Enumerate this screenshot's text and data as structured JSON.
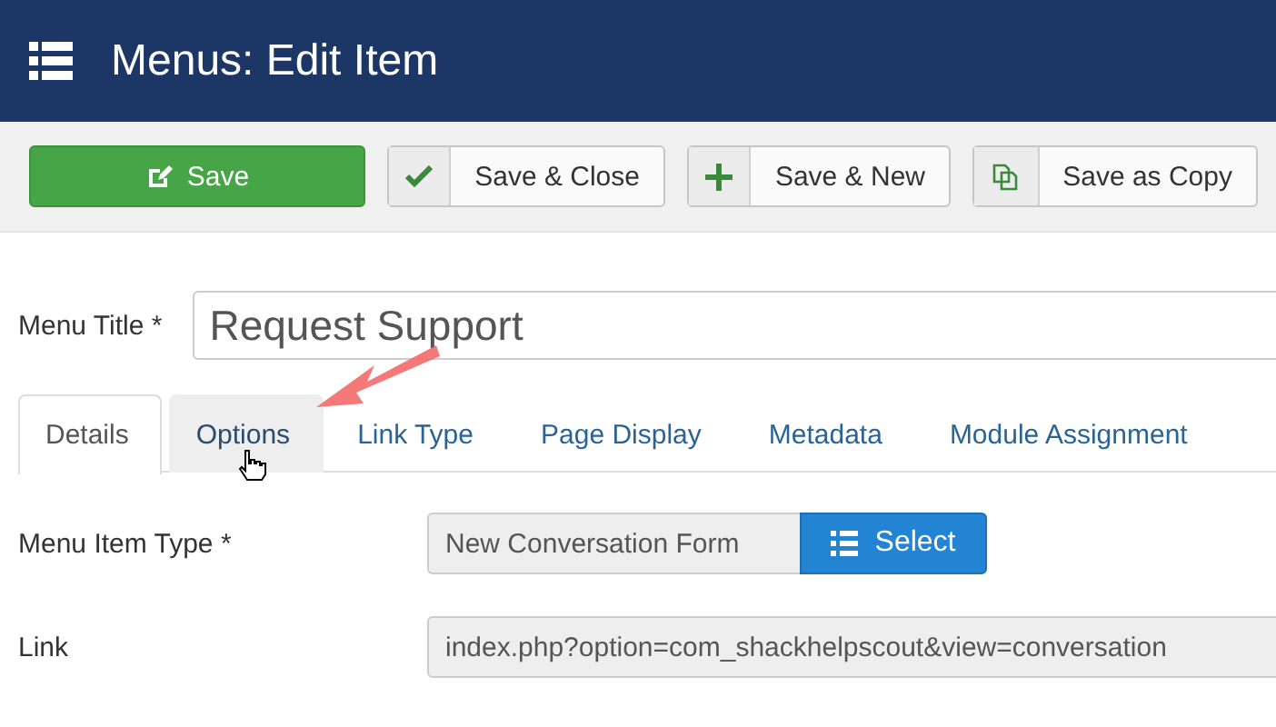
{
  "header": {
    "title": "Menus: Edit Item"
  },
  "toolbar": [
    {
      "label": "Save",
      "kind": "primary"
    },
    {
      "label": "Save & Close",
      "kind": "default"
    },
    {
      "label": "Save & New",
      "kind": "default"
    },
    {
      "label": "Save as Copy",
      "kind": "default"
    }
  ],
  "menu_title": {
    "label": "Menu Title *",
    "value": "Request Support"
  },
  "tabs": [
    {
      "label": "Details",
      "selected": true,
      "hovered": false
    },
    {
      "label": "Options",
      "selected": false,
      "hovered": true
    },
    {
      "label": "Link Type",
      "selected": false,
      "hovered": false
    },
    {
      "label": "Page Display",
      "selected": false,
      "hovered": false
    },
    {
      "label": "Metadata",
      "selected": false,
      "hovered": false
    },
    {
      "label": "Module Assignment",
      "selected": false,
      "hovered": false
    }
  ],
  "menu_item_type": {
    "label": "Menu Item Type *",
    "value": "New Conversation Form",
    "button": "Select"
  },
  "link": {
    "label": "Link",
    "value": "index.php?option=com_shackhelpscout&view=conversation"
  }
}
